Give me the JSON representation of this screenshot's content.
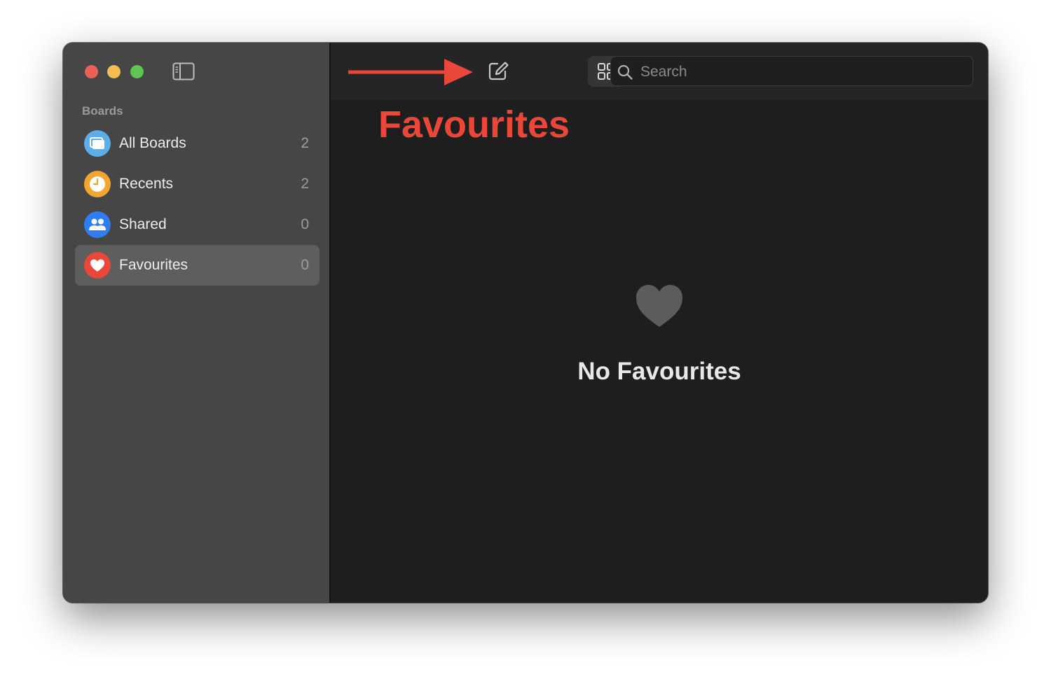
{
  "sidebar": {
    "section_label": "Boards",
    "items": [
      {
        "label": "All Boards",
        "count": "2",
        "icon": "boards-icon",
        "color": "#5aaeea"
      },
      {
        "label": "Recents",
        "count": "2",
        "icon": "clock-icon",
        "color": "#f0a630"
      },
      {
        "label": "Shared",
        "count": "0",
        "icon": "people-icon",
        "color": "#2f7df1"
      },
      {
        "label": "Favourites",
        "count": "0",
        "icon": "heart-icon",
        "color": "#e8473a",
        "selected": true
      }
    ]
  },
  "toolbar": {
    "buttons": [
      {
        "name": "new-board-button",
        "icon": "compose-icon"
      },
      {
        "name": "grid-view-button",
        "icon": "grid-icon",
        "active": true
      },
      {
        "name": "list-view-button",
        "icon": "list-icon"
      }
    ]
  },
  "search": {
    "placeholder": "Search",
    "value": ""
  },
  "annotation": {
    "title": "Favourites",
    "color": "#e8473a"
  },
  "main": {
    "empty_state": {
      "icon": "heart-icon",
      "title": "No Favourites"
    }
  },
  "colors": {
    "close": "#ec5f57",
    "minimize": "#f4bd4f",
    "zoom": "#5fc454",
    "sidebar_bg": "#464646",
    "main_bg": "#1e1e1e"
  }
}
